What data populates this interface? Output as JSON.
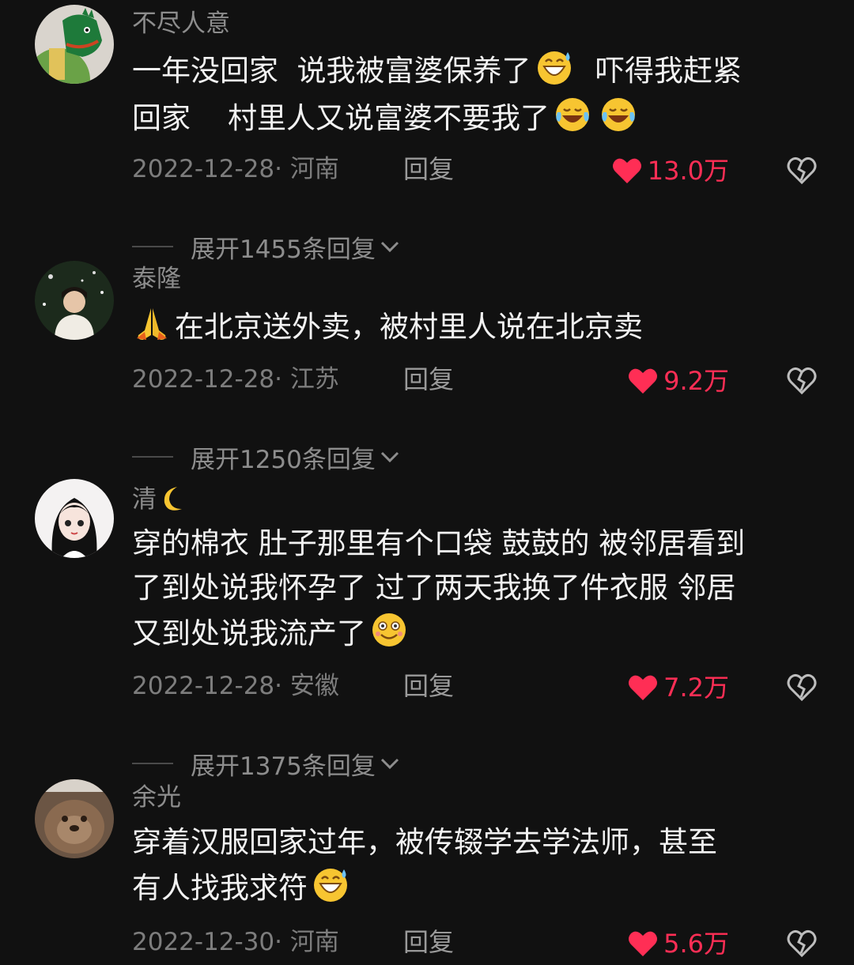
{
  "comments": [
    {
      "username": "不尽人意",
      "lines": [
        [
          "一年没回家  说我被富婆保养了",
          "emoji:grin-sweat",
          "  吓得我赶紧"
        ],
        [
          "回家    村里人又说富婆不要我了",
          "emoji:tears-joy",
          "emoji:tears-joy"
        ]
      ],
      "date": "2022-12-28",
      "location": "河南",
      "reply_label": "回复",
      "likes": "13.0万",
      "expand_label": "展开1455条回复"
    },
    {
      "username": "泰隆",
      "lines": [
        [
          "emoji:pray",
          "在北京送外卖，被村里人说在北京卖"
        ]
      ],
      "date": "2022-12-28",
      "location": "江苏",
      "reply_label": "回复",
      "likes": "9.2万",
      "expand_label": "展开1250条回复"
    },
    {
      "username": "清",
      "username_icon": "crescent-moon",
      "lines": [
        [
          "穿的棉衣 肚子那里有个口袋 鼓鼓的 被邻居看到"
        ],
        [
          "了到处说我怀孕了 过了两天我换了件衣服 邻居"
        ],
        [
          "又到处说我流产了",
          "emoji:smile"
        ]
      ],
      "date": "2022-12-28",
      "location": "安徽",
      "reply_label": "回复",
      "likes": "7.2万",
      "expand_label": "展开1375条回复"
    },
    {
      "username": "余光",
      "lines": [
        [
          "穿着汉服回家过年，被传辍学去学法师，甚至"
        ],
        [
          "有人找我求符",
          "emoji:grin-sweat"
        ]
      ],
      "date": "2022-12-30",
      "location": "河南",
      "reply_label": "回复",
      "likes": "5.6万"
    }
  ],
  "icons": {
    "like": "heart-icon",
    "dislike": "broken-heart-icon",
    "expand": "chevron-down-icon"
  },
  "colors": {
    "background": "#111111",
    "like": "#ff2e55",
    "username": "#8d8d8d",
    "text": "#f2f2f2"
  }
}
